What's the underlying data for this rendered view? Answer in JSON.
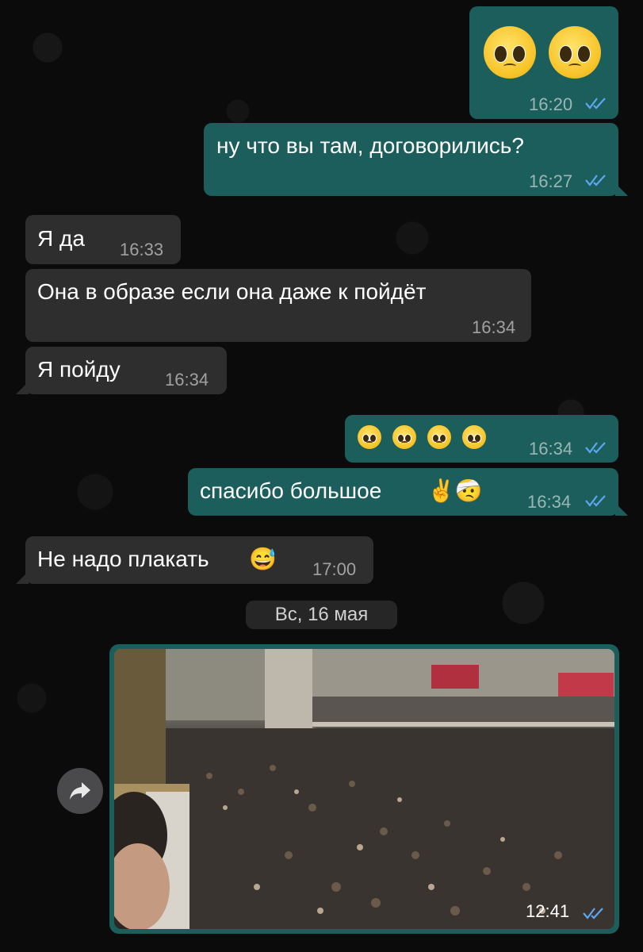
{
  "messages": [
    {
      "id": "m1",
      "dir": "out",
      "text": "",
      "emoji_count": 2,
      "time": "16:20"
    },
    {
      "id": "m2",
      "dir": "out",
      "text": "ну что вы там, договорились?",
      "time": "16:27"
    },
    {
      "id": "m3",
      "dir": "in",
      "text": "Я да",
      "time": "16:33"
    },
    {
      "id": "m4",
      "dir": "in",
      "text": "Она в образе если она даже к пойдёт",
      "time": "16:34"
    },
    {
      "id": "m5",
      "dir": "in",
      "text": "Я пойду",
      "time": "16:34"
    },
    {
      "id": "m6",
      "dir": "out",
      "text": "",
      "emoji_count": 4,
      "time": "16:34"
    },
    {
      "id": "m7",
      "dir": "out",
      "text": "спасибо большое",
      "emoji": "✌️🤕",
      "time": "16:34"
    },
    {
      "id": "m8",
      "dir": "in",
      "text": "Не надо плакать",
      "emoji": "😅",
      "time": "17:00"
    }
  ],
  "date_separator": "Вс, 16 мая",
  "photo_message": {
    "time": "12:41",
    "description_icon": "image"
  },
  "icons": {
    "read": "double-check-icon",
    "forward": "forward-arrow-icon"
  },
  "colors": {
    "outgoing": "#1c5e5b",
    "incoming": "#2e2e2f",
    "read_check": "#5ba7f0"
  }
}
